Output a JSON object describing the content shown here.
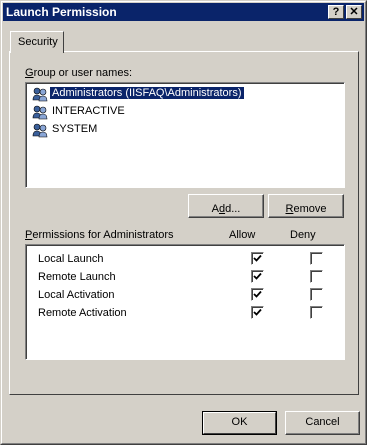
{
  "window": {
    "title": "Launch Permission",
    "help_glyph": "?",
    "close_glyph": "✕"
  },
  "tab": {
    "label": "Security"
  },
  "group": {
    "label_prefix": "",
    "label_ul": "G",
    "label_rest": "roup or user names:",
    "users": [
      {
        "name": "Administrators (IISFAQ\\Administrators)",
        "selected": true,
        "icon": "users-icon"
      },
      {
        "name": "INTERACTIVE",
        "selected": false,
        "icon": "users-icon"
      },
      {
        "name": "SYSTEM",
        "selected": false,
        "icon": "users-icon"
      }
    ]
  },
  "buttons": {
    "add_pre": "A",
    "add_ul": "d",
    "add_post": "d...",
    "remove_pre": "",
    "remove_ul": "R",
    "remove_post": "emove",
    "ok": "OK",
    "cancel": "Cancel"
  },
  "permissions": {
    "label_ul": "P",
    "label_rest": "ermissions for Administrators",
    "allow_header": "Allow",
    "deny_header": "Deny",
    "rows": [
      {
        "name": "Local Launch",
        "allow": true,
        "deny": false
      },
      {
        "name": "Remote Launch",
        "allow": true,
        "deny": false
      },
      {
        "name": "Local Activation",
        "allow": true,
        "deny": false
      },
      {
        "name": "Remote Activation",
        "allow": true,
        "deny": false
      }
    ]
  },
  "colors": {
    "face": "#d4d0c8",
    "titlebar": "#0a246a",
    "selection": "#0a246a"
  }
}
